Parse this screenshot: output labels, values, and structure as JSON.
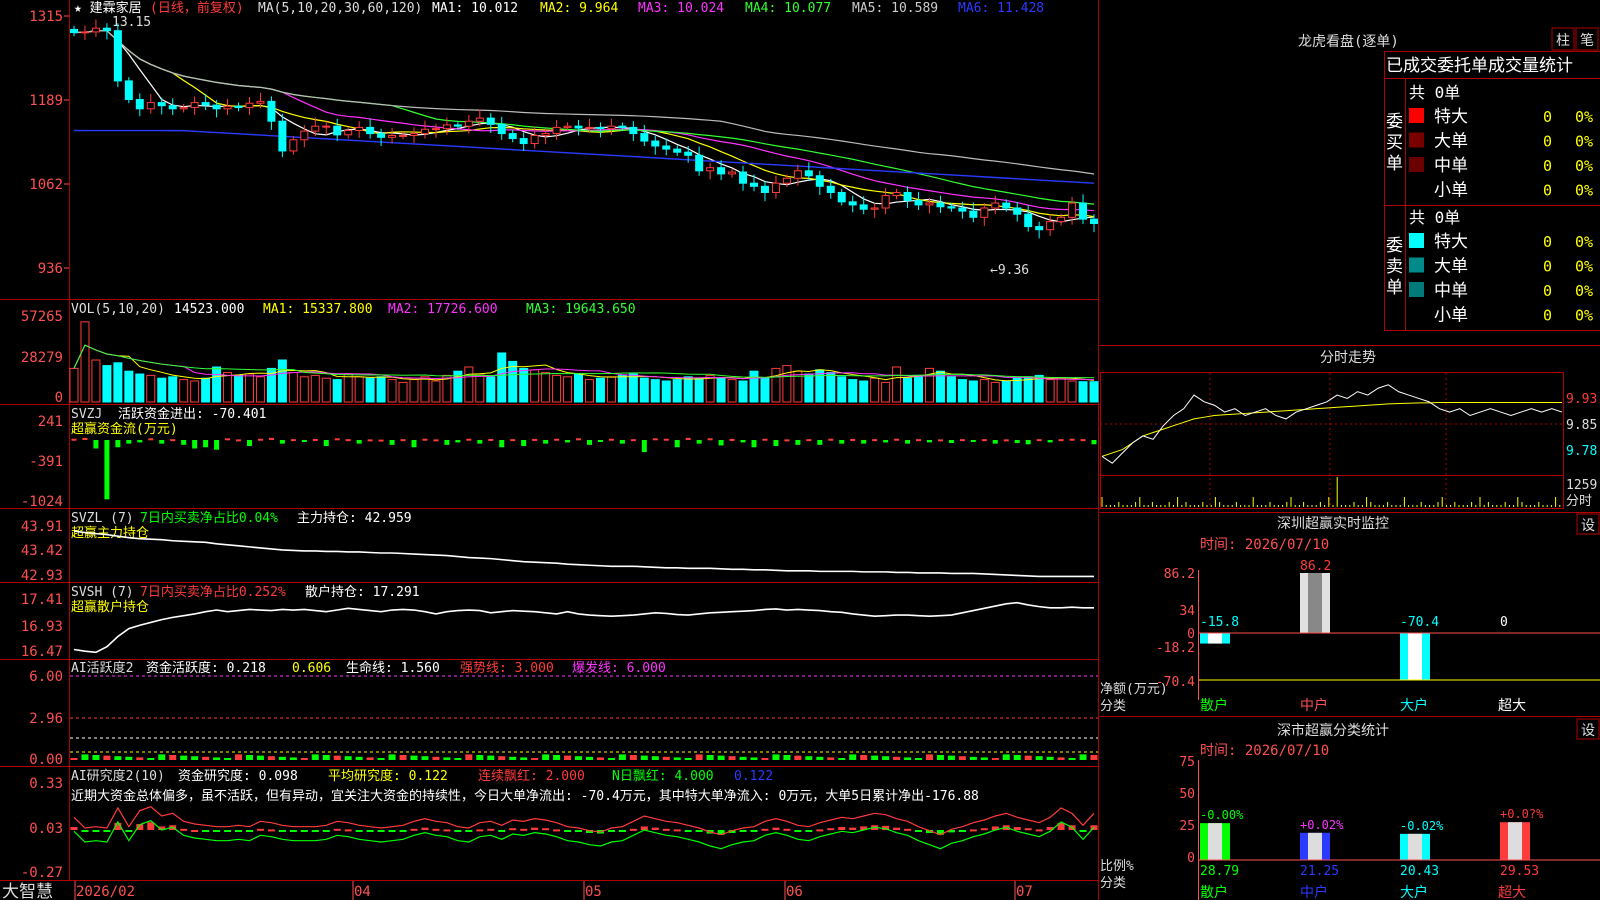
{
  "colors": {
    "up": "#ff3b3b",
    "down": "#00ffff",
    "ma1": "#ffffff",
    "ma2": "#ffff00",
    "ma3": "#ff33ff",
    "ma4": "#33ff33",
    "ma5": "#bbbbbb",
    "ma6": "#2a3aff",
    "grid": "#b00000",
    "axis": "#ff5050",
    "green": "#00ff00",
    "magenta": "#ff33ff",
    "yellow": "#ffff00",
    "white": "#ffffff"
  },
  "stock": {
    "name": "★ 建霖家居",
    "period": "(日线，前复权)"
  },
  "main_panel": {
    "legend": [
      "MA(5,10,20,30,60,120)",
      "MA1: 10.012",
      "MA2: 9.964",
      "MA3: 10.024",
      "MA4: 10.077",
      "MA5: 10.589",
      "MA6: 11.428"
    ],
    "y_ticks": [
      "1315",
      "1189",
      "1062",
      "936"
    ],
    "high_label": "13.15",
    "low_label": "←9.36"
  },
  "vol_panel": {
    "legend": [
      "VOL(5,10,20)",
      "14523.000",
      "MA1: 15337.800",
      "MA2: 17726.600",
      "MA3: 19643.650"
    ],
    "y_ticks": [
      "57265",
      "28279",
      "0"
    ]
  },
  "svzj_panel": {
    "legend": [
      "SVZJ",
      "活跃资金进出: -70.401"
    ],
    "sub": "超赢资金流(万元)",
    "y_ticks": [
      "241",
      "-391",
      "-1024"
    ]
  },
  "svzl_panel": {
    "legend": [
      "SVZL (7)",
      "7日内买卖净占比0.04%",
      "主力持仓: 42.959"
    ],
    "sub": "超赢主力持仓",
    "y_ticks": [
      "43.91",
      "43.42",
      "42.93"
    ]
  },
  "svsh_panel": {
    "legend": [
      "SVSH (7)",
      "7日内买卖净占比0.252%",
      "散户持仓: 17.291"
    ],
    "sub": "超赢散户持仓",
    "y_ticks": [
      "17.41",
      "16.93",
      "16.47"
    ]
  },
  "ai_active": {
    "legend": [
      "AI活跃度2",
      "资金活跃度: 0.218",
      "0.606",
      "生命线: 1.560",
      "强势线: 3.000",
      "爆发线: 6.000"
    ],
    "y_ticks": [
      "6.00",
      "2.96",
      "0.00"
    ]
  },
  "ai_research": {
    "legend": [
      "AI研究度2(10)",
      "资金研究度: 0.098",
      "平均研究度: 0.122",
      "连续飘红: 2.000",
      "N日飘红: 4.000",
      "0.122"
    ],
    "comment": "近期大资金总体偏多，虽不活跃，但有异动，宜关注大资金的持续性，今日大单净流出: -70.4万元，其中特大单净流入: 0万元，大单5日累计净出-176.88",
    "y_ticks": [
      "0.33",
      "0.03",
      "-0.27"
    ]
  },
  "x_axis": {
    "brand": "大智慧",
    "labels": [
      "2026/02",
      "04",
      "05",
      "06",
      "07"
    ]
  },
  "dragon": {
    "title": "龙虎看盘(逐单)",
    "btn_col": "柱",
    "btn_pen": "笔",
    "stats_title": "已成交委托单成交量统计",
    "buy_label": "委买单",
    "sell_label": "委卖单",
    "buy_total": "共 0单",
    "sell_total": "共 0单",
    "buy_rows": [
      {
        "name": "特大",
        "count": "0",
        "pct": "0%"
      },
      {
        "name": "大单",
        "count": "0",
        "pct": "0%"
      },
      {
        "name": "中单",
        "count": "0",
        "pct": "0%"
      },
      {
        "name": "小单",
        "count": "0",
        "pct": "0%"
      }
    ],
    "sell_rows": [
      {
        "name": "特大",
        "count": "0",
        "pct": "0%"
      },
      {
        "name": "大单",
        "count": "0",
        "pct": "0%"
      },
      {
        "name": "中单",
        "count": "0",
        "pct": "0%"
      },
      {
        "name": "小单",
        "count": "0",
        "pct": "0%"
      }
    ]
  },
  "intraday": {
    "title": "分时走势",
    "prices": [
      "9.93",
      "9.85",
      "9.78"
    ],
    "vol": "1259",
    "vol_unit": "分时"
  },
  "monitor": {
    "title": "深圳超赢实时监控",
    "setting": "设",
    "date": "时间: 2026/07/10",
    "y_ticks": [
      "86.2",
      "34",
      "0",
      "-18.2",
      "-70.4"
    ],
    "y_unit": "净额(万元)",
    "x_unit": "分类",
    "categories": [
      "散户",
      "中户",
      "大户",
      "超大"
    ],
    "values": [
      -15.8,
      86.2,
      -70.4,
      0
    ],
    "labels": [
      "-15.8",
      "86.2",
      "-70.4",
      "0"
    ]
  },
  "classify": {
    "title": "深市超赢分类统计",
    "setting": "设",
    "date": "时间: 2026/07/10",
    "y_ticks": [
      "75",
      "50",
      "25",
      "0"
    ],
    "y_unit": "比例%",
    "x_unit": "分类",
    "categories": [
      "散户",
      "中户",
      "大户",
      "超大"
    ],
    "values": [
      28.79,
      21.25,
      20.43,
      29.53
    ],
    "changes": [
      "-0.00%",
      "+0.02%",
      "-0.02%",
      "+0.0?%"
    ],
    "bottom_labels": [
      "28.79",
      "21.25",
      "20.43",
      "29.53"
    ]
  },
  "chart_data": {
    "type": "candlestick",
    "ylim": [
      9.36,
      13.15
    ],
    "count": 94,
    "close": [
      13.03,
      13.04,
      13.1,
      13.06,
      12.25,
      11.95,
      11.8,
      11.9,
      11.85,
      11.8,
      11.82,
      11.9,
      11.86,
      11.8,
      11.84,
      11.82,
      11.89,
      11.92,
      11.6,
      11.12,
      11.3,
      11.44,
      11.52,
      11.52,
      11.38,
      11.45,
      11.5,
      11.4,
      11.34,
      11.37,
      11.37,
      11.4,
      11.47,
      11.48,
      11.54,
      11.52,
      11.6,
      11.65,
      11.55,
      11.4,
      11.32,
      11.24,
      11.37,
      11.4,
      11.5,
      11.52,
      11.49,
      11.5,
      11.48,
      11.52,
      11.5,
      11.4,
      11.28,
      11.2,
      11.15,
      11.1,
      11.05,
      10.8,
      10.85,
      10.75,
      10.78,
      10.6,
      10.55,
      10.45,
      10.6,
      10.68,
      10.8,
      10.72,
      10.55,
      10.45,
      10.3,
      10.25,
      10.18,
      10.2,
      10.4,
      10.45,
      10.32,
      10.25,
      10.28,
      10.22,
      10.2,
      10.15,
      10.05,
      10.2,
      10.28,
      10.2,
      10.1,
      9.9,
      9.85,
      9.98,
      10.05,
      10.28,
      10.02,
      9.95
    ],
    "volume": [
      24000,
      57265,
      30000,
      26000,
      28000,
      22000,
      20000,
      19000,
      17000,
      18000,
      16000,
      15000,
      17000,
      25000,
      21000,
      19000,
      20000,
      18000,
      24000,
      30000,
      21000,
      18000,
      19000,
      17000,
      16000,
      20000,
      18000,
      17000,
      18000,
      16000,
      14000,
      16000,
      18000,
      15000,
      19000,
      22000,
      25000,
      20000,
      18000,
      35000,
      29000,
      24000,
      23000,
      21000,
      19000,
      18000,
      20000,
      16000,
      17000,
      18000,
      19000,
      20000,
      17000,
      16000,
      15000,
      16000,
      18000,
      17000,
      19000,
      17000,
      16000,
      15000,
      22000,
      17000,
      24000,
      26000,
      22000,
      20000,
      23000,
      21000,
      18000,
      16000,
      15000,
      17000,
      14000,
      25000,
      17000,
      19000,
      24000,
      22000,
      18000,
      16000,
      15000,
      16000,
      14000,
      15000,
      17000,
      18000,
      19000,
      16000,
      17000,
      15000,
      14523,
      14523
    ],
    "flow": [
      60,
      100,
      -140,
      -980,
      -120,
      -60,
      -40,
      80,
      -60,
      40,
      -80,
      -140,
      -120,
      -160,
      80,
      30,
      -100,
      60,
      100,
      -60,
      40,
      -20,
      50,
      -100,
      80,
      40,
      -60,
      30,
      20,
      -80,
      40,
      -120,
      60,
      30,
      -80,
      -40,
      60,
      -60,
      50,
      -120,
      40,
      -100,
      50,
      -60,
      60,
      -40,
      80,
      -80,
      -30,
      60,
      -60,
      40,
      -200,
      80,
      60,
      -120,
      100,
      -60,
      80,
      -90,
      50,
      -40,
      -120,
      60,
      -100,
      30,
      -80,
      40,
      -80,
      60,
      -60,
      50,
      -60,
      40,
      -40,
      60,
      -60,
      40,
      -40,
      30,
      -50,
      40,
      -30,
      40,
      -60,
      30,
      -50,
      -70,
      40,
      -40,
      40,
      60,
      40,
      -70
    ],
    "main_hold": [
      43.85,
      43.82,
      43.8,
      43.78,
      43.75,
      43.72,
      43.7,
      43.69,
      43.68,
      43.66,
      43.65,
      43.64,
      43.63,
      43.6,
      43.58,
      43.56,
      43.54,
      43.52,
      43.5,
      43.48,
      43.47,
      43.46,
      43.46,
      43.45,
      43.45,
      43.44,
      43.44,
      43.43,
      43.42,
      43.42,
      43.41,
      43.4,
      43.39,
      43.38,
      43.37,
      43.35,
      43.33,
      43.32,
      43.31,
      43.29,
      43.27,
      43.25,
      43.24,
      43.23,
      43.22,
      43.2,
      43.19,
      43.18,
      43.17,
      43.16,
      43.16,
      43.16,
      43.15,
      43.14,
      43.13,
      43.13,
      43.12,
      43.12,
      43.12,
      43.11,
      43.1,
      43.1,
      43.09,
      43.09,
      43.08,
      43.07,
      43.07,
      43.07,
      43.06,
      43.06,
      43.06,
      43.06,
      43.05,
      43.05,
      43.05,
      43.04,
      43.04,
      43.03,
      43.03,
      43.03,
      43.02,
      43.02,
      43.02,
      43.01,
      43.0,
      42.99,
      42.98,
      42.97,
      42.96,
      42.96,
      42.96,
      42.96,
      42.96,
      42.96
    ],
    "retail_hold": [
      16.55,
      16.52,
      16.5,
      16.6,
      16.78,
      16.92,
      16.98,
      17.03,
      17.08,
      17.12,
      17.15,
      17.18,
      17.22,
      17.25,
      17.22,
      17.24,
      17.26,
      17.25,
      17.24,
      17.26,
      17.25,
      17.26,
      17.24,
      17.22,
      17.25,
      17.28,
      17.26,
      17.24,
      17.22,
      17.25,
      17.26,
      17.25,
      17.22,
      17.18,
      17.22,
      17.24,
      17.25,
      17.24,
      17.2,
      17.22,
      17.24,
      17.23,
      17.22,
      17.2,
      17.18,
      17.22,
      17.18,
      17.16,
      17.15,
      17.14,
      17.15,
      17.16,
      17.18,
      17.2,
      17.19,
      17.17,
      17.16,
      17.18,
      17.2,
      17.21,
      17.22,
      17.23,
      17.24,
      17.26,
      17.27,
      17.25,
      17.26,
      17.25,
      17.24,
      17.22,
      17.21,
      17.18,
      17.16,
      17.14,
      17.15,
      17.16,
      17.16,
      17.15,
      17.14,
      17.15,
      17.16,
      17.2,
      17.24,
      17.28,
      17.32,
      17.36,
      17.38,
      17.34,
      17.31,
      17.29,
      17.29,
      17.3,
      17.29,
      17.29
    ],
    "research": [
      0.05,
      -0.03,
      -0.02,
      -0.03,
      0.12,
      -0.02,
      0.1,
      0.13,
      0.06,
      0.08,
      0.02,
      0.0,
      -0.01,
      -0.02,
      -0.02,
      -0.01,
      -0.02,
      0.02,
      0.01,
      -0.01,
      -0.02,
      -0.02,
      -0.02,
      -0.01,
      0.02,
      0.01,
      -0.01,
      -0.02,
      -0.03,
      -0.02,
      -0.01,
      0.02,
      0.04,
      0.02,
      0.01,
      -0.02,
      -0.03,
      0.01,
      0.02,
      -0.01,
      0.03,
      0.02,
      0.04,
      0.03,
      0.01,
      -0.02,
      -0.03,
      -0.05,
      -0.06,
      -0.03,
      -0.02,
      0.02,
      0.06,
      0.04,
      0.02,
      0.01,
      -0.01,
      -0.03,
      -0.06,
      -0.08,
      -0.05,
      -0.03,
      -0.02,
      0.02,
      0.04,
      0.02,
      -0.01,
      -0.02,
      0.01,
      0.03,
      0.05,
      0.04,
      0.06,
      0.08,
      0.07,
      0.04,
      0.02,
      -0.02,
      -0.05,
      -0.08,
      -0.04,
      -0.02,
      0.01,
      0.03,
      0.06,
      0.08,
      0.05,
      0.03,
      0.01,
      0.05,
      0.12,
      0.08,
      -0.01,
      0.08
    ],
    "intraday_price": [
      9.74,
      9.72,
      9.75,
      9.78,
      9.8,
      9.79,
      9.83,
      9.86,
      9.88,
      9.92,
      9.9,
      9.89,
      9.87,
      9.88,
      9.86,
      9.87,
      9.88,
      9.86,
      9.85,
      9.87,
      9.88,
      9.89,
      9.9,
      9.92,
      9.91,
      9.93,
      9.92,
      9.94,
      9.95,
      9.93,
      9.92,
      9.91,
      9.9,
      9.88,
      9.87,
      9.88,
      9.86,
      9.87,
      9.88,
      9.87,
      9.86,
      9.87,
      9.88,
      9.87,
      9.88,
      9.87
    ],
    "intraday_avg": [
      9.74,
      9.75,
      9.76,
      9.78,
      9.8,
      9.81,
      9.82,
      9.83,
      9.84,
      9.85,
      9.855,
      9.86,
      9.862,
      9.864,
      9.866,
      9.868,
      9.87,
      9.872,
      9.874,
      9.876,
      9.878,
      9.88,
      9.882,
      9.884,
      9.886,
      9.888,
      9.89,
      9.892,
      9.894,
      9.895,
      9.896,
      9.897,
      9.897,
      9.898,
      9.898,
      9.898,
      9.898,
      9.898,
      9.898,
      9.898,
      9.898,
      9.898,
      9.898,
      9.898,
      9.898,
      9.898
    ]
  }
}
